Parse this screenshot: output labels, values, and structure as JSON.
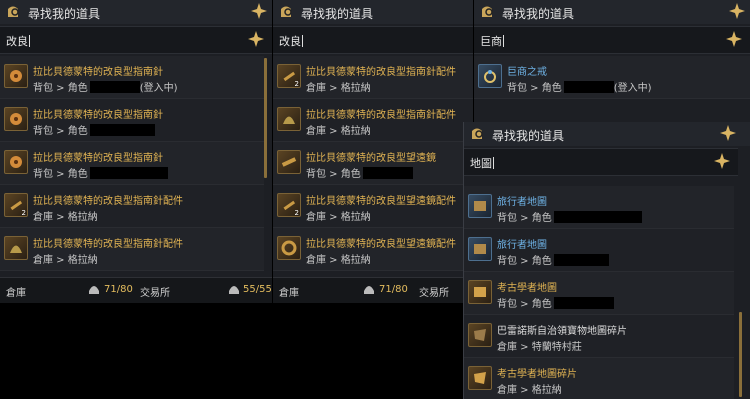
{
  "colors": {
    "gold_text": "#e2b453",
    "blue_text": "#6fb3e6"
  },
  "panel1": {
    "title": "尋找我的道具",
    "search_value": "改良",
    "items": [
      {
        "name": "拉比貝德蒙特的改良型指南針",
        "loc_prefix": "背包 > 角色",
        "loc_suffix": "(登入中)",
        "icon": "compass-icon",
        "count": ""
      },
      {
        "name": "拉比貝德蒙特的改良型指南針",
        "loc_prefix": "背包 > 角色",
        "loc_suffix": "",
        "icon": "compass-icon",
        "count": ""
      },
      {
        "name": "拉比貝德蒙特的改良型指南針",
        "loc_prefix": "背包 > 角色",
        "loc_suffix": "",
        "icon": "compass-icon",
        "count": ""
      },
      {
        "name": "拉比貝德蒙特的改良型指南針配件",
        "loc_prefix": "倉庫 > 格拉納",
        "loc_suffix": "",
        "icon": "tools-icon",
        "count": "2"
      },
      {
        "name": "拉比貝德蒙特的改良型指南針配件",
        "loc_prefix": "倉庫 > 格拉納",
        "loc_suffix": "",
        "icon": "shell-icon",
        "count": ""
      }
    ],
    "footer": {
      "storage_label": "倉庫",
      "storage_cap": "71/80",
      "exchange_label": "交易所",
      "exchange_cap": "55/55"
    }
  },
  "panel2": {
    "title": "尋找我的道具",
    "search_value": "改良",
    "items": [
      {
        "name": "拉比貝德蒙特的改良型指南針配件",
        "loc_prefix": "倉庫 > 格拉納",
        "icon": "tools-icon",
        "count": "2"
      },
      {
        "name": "拉比貝德蒙特的改良型指南針配件",
        "loc_prefix": "倉庫 > 格拉納",
        "icon": "shell-icon",
        "count": ""
      },
      {
        "name": "拉比貝德蒙特的改良型望遠鏡",
        "loc_prefix": "背包 > 角色",
        "icon": "telescope-icon",
        "count": ""
      },
      {
        "name": "拉比貝德蒙特的改良型望遠鏡配件",
        "loc_prefix": "倉庫 > 格拉納",
        "icon": "tools-icon",
        "count": "2"
      },
      {
        "name": "拉比貝德蒙特的改良型望遠鏡配件",
        "loc_prefix": "倉庫 > 格拉納",
        "icon": "gear-icon",
        "count": ""
      }
    ],
    "footer": {
      "storage_label": "倉庫",
      "storage_cap": "71/80",
      "exchange_label": "交易所"
    }
  },
  "panel3": {
    "title": "尋找我的道具",
    "search_value": "巨商",
    "items": [
      {
        "name": "巨商之戒",
        "loc_prefix": "背包 > 角色",
        "loc_suffix": "(登入中)",
        "icon": "ring-icon"
      }
    ]
  },
  "panel4": {
    "title": "尋找我的道具",
    "search_value": "地圖",
    "items": [
      {
        "name": "旅行者地圖",
        "loc_prefix": "背包 > 角色",
        "icon": "map-icon",
        "style": "blue"
      },
      {
        "name": "旅行者地圖",
        "loc_prefix": "背包 > 角色",
        "icon": "map-icon",
        "style": "blue"
      },
      {
        "name": "考古學者地圖",
        "loc_prefix": "背包 > 角色",
        "icon": "map-icon",
        "style": "gold"
      },
      {
        "name": "巴雷諾斯自治領寶物地圖碎片",
        "loc_prefix": "倉庫 > 特蘭特村莊",
        "icon": "map-fragment-icon",
        "style": "white"
      },
      {
        "name": "考古學者地圖碎片",
        "loc_prefix": "倉庫 > 格拉納",
        "icon": "map-fragment-icon",
        "style": "gold"
      }
    ]
  }
}
